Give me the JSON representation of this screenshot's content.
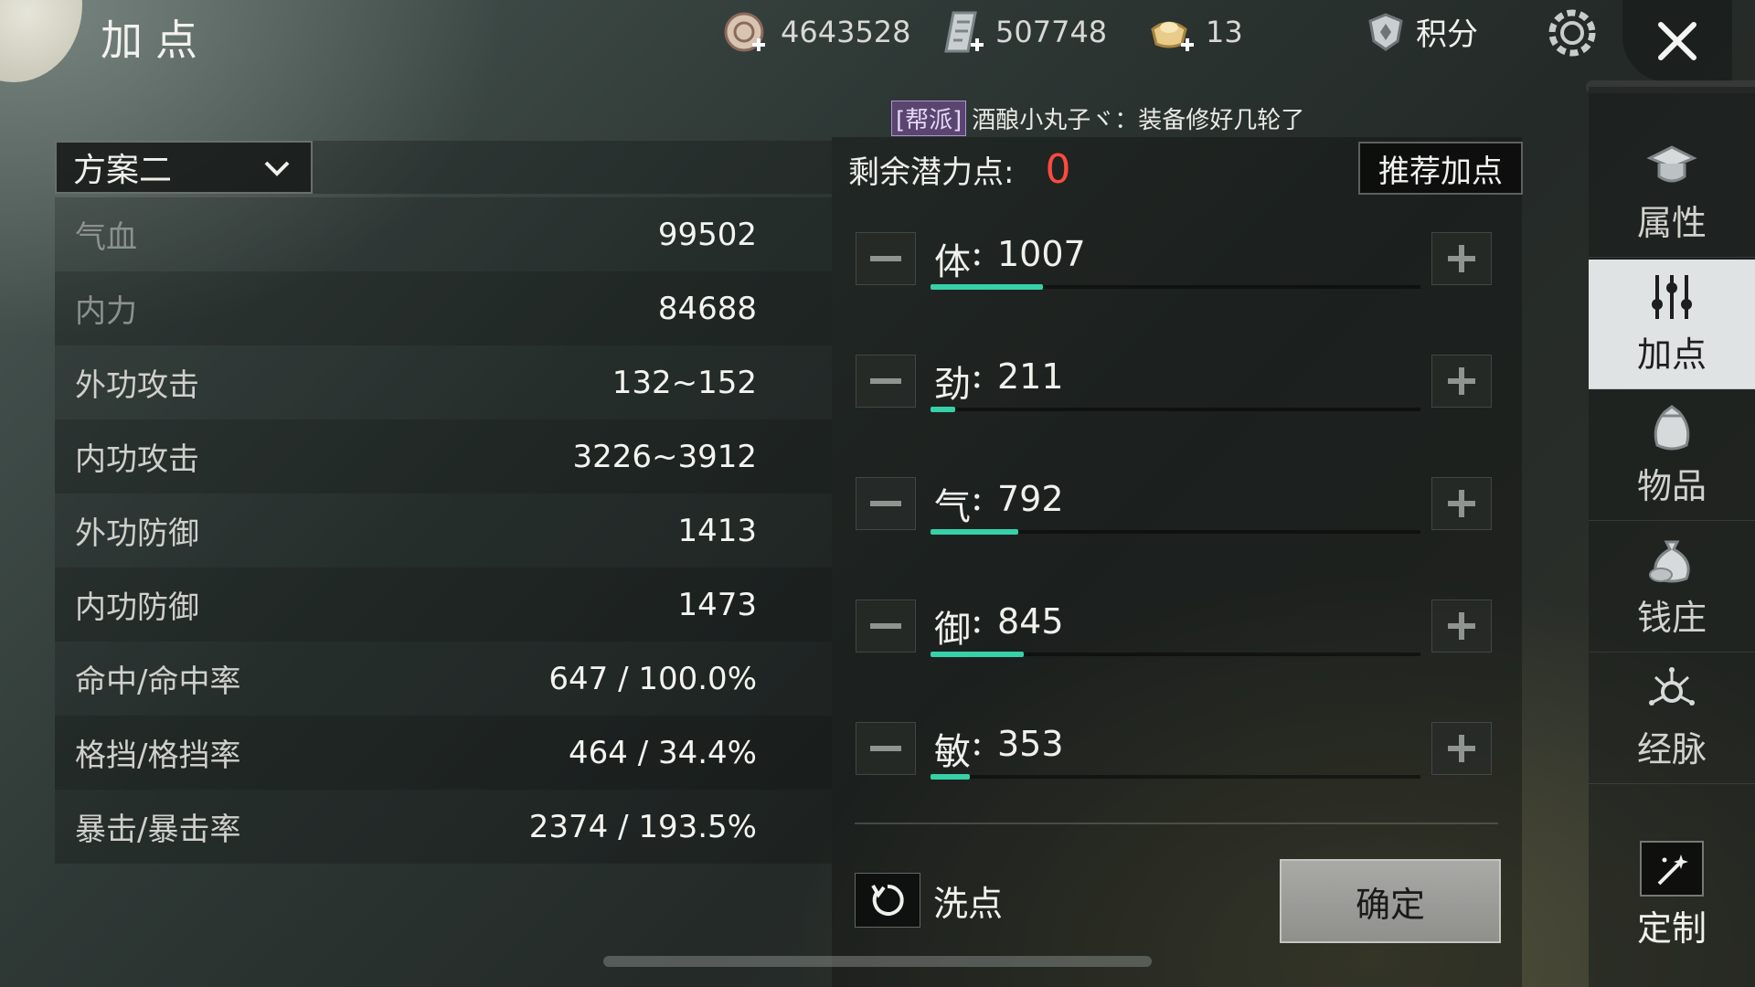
{
  "header": {
    "title": "加点",
    "resources": [
      {
        "icon": "gold-coin-plus-icon",
        "value": "4643528"
      },
      {
        "icon": "silver-scroll-plus-icon",
        "value": "507748"
      },
      {
        "icon": "ingot-plus-icon",
        "value": "13"
      }
    ],
    "score_label": "积分"
  },
  "chat": {
    "channel": "[帮派]",
    "message": "酒酿小丸子ヾ：装备修好几轮了"
  },
  "scheme": {
    "selected": "方案二"
  },
  "stats": [
    {
      "name": "气血",
      "value": "99502"
    },
    {
      "name": "内力",
      "value": "84688"
    },
    {
      "name": "外功攻击",
      "value": "132~152"
    },
    {
      "name": "内功攻击",
      "value": "3226~3912"
    },
    {
      "name": "外功防御",
      "value": "1413"
    },
    {
      "name": "内功防御",
      "value": "1473"
    },
    {
      "name": "命中/命中率",
      "value": "647 / 100.0%"
    },
    {
      "name": "格挡/格挡率",
      "value": "464 / 34.4%"
    },
    {
      "name": "暴击/暴击率",
      "value": "2374 / 193.5%"
    }
  ],
  "potential": {
    "label": "剩余潜力点:",
    "value": "0",
    "recommend_label": "推荐加点"
  },
  "attributes": [
    {
      "name": "体",
      "value": "1007",
      "fill": 0.23
    },
    {
      "name": "劲",
      "value": "211",
      "fill": 0.05
    },
    {
      "name": "气",
      "value": "792",
      "fill": 0.18
    },
    {
      "name": "御",
      "value": "845",
      "fill": 0.19
    },
    {
      "name": "敏",
      "value": "353",
      "fill": 0.08
    }
  ],
  "actions": {
    "wash_label": "洗点",
    "confirm_label": "确定"
  },
  "nav": [
    {
      "label": "属性",
      "icon": "attribute-hat-icon",
      "active": false
    },
    {
      "label": "加点",
      "icon": "sliders-icon",
      "active": true
    },
    {
      "label": "物品",
      "icon": "item-bag-icon",
      "active": false
    },
    {
      "label": "钱庄",
      "icon": "money-bag-icon",
      "active": false
    },
    {
      "label": "经脉",
      "icon": "meridian-icon",
      "active": false
    }
  ],
  "custom_label": "定制",
  "colors": {
    "accent_fill": "#36d1a8",
    "zero_red": "#ff4a3e",
    "active_nav_bg": "#f0f4f5"
  }
}
